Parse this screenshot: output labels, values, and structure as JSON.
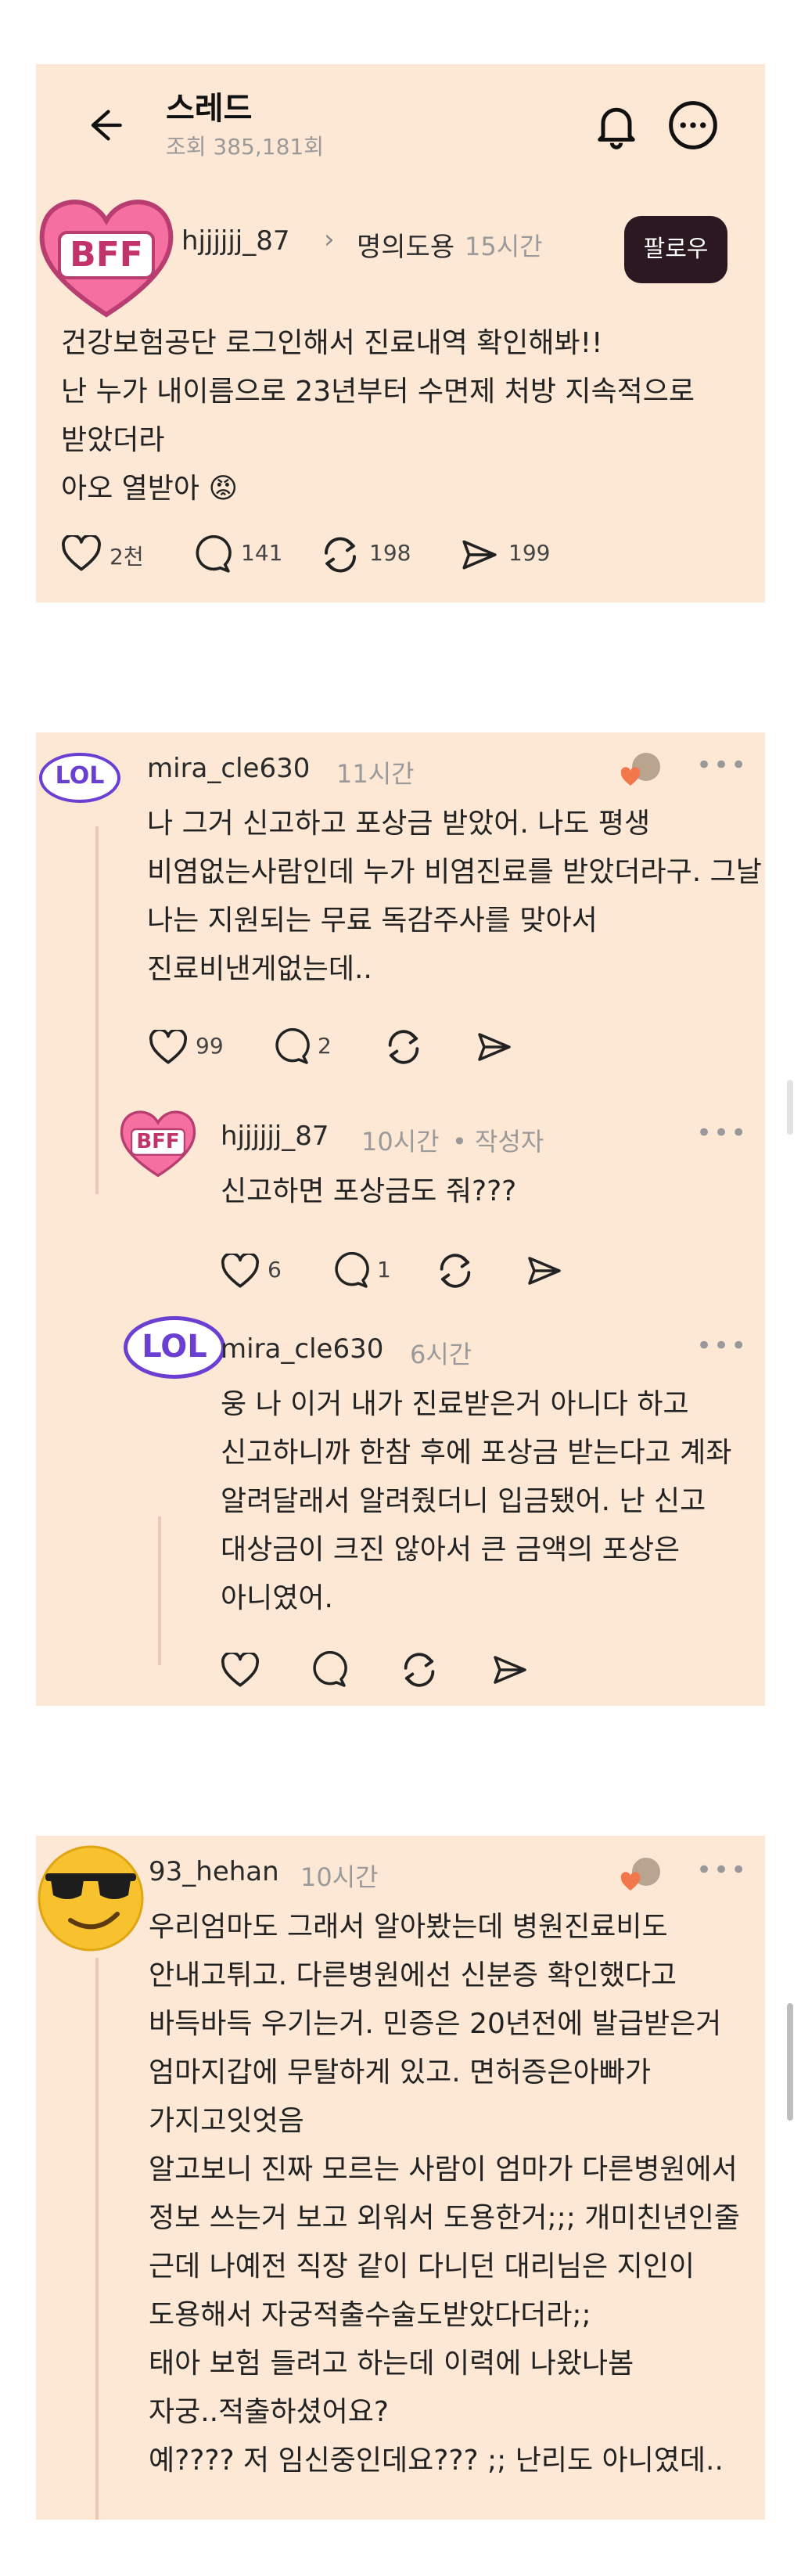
{
  "header": {
    "title": "스레드",
    "views": "조회 385,181회"
  },
  "post": {
    "avatar_text": "BFF",
    "username": "hjjjjjj_87",
    "community": "명의도용",
    "time": "15시간",
    "follow_label": "팔로우",
    "lines": [
      "건강보험공단 로그인해서 진료내역 확인해봐!!",
      "난 누가 내이름으로 23년부터 수면제 처방 지속적으로",
      "받았더라",
      "아오 열받아 😡"
    ],
    "likes": "2천",
    "comments": "141",
    "reposts": "198",
    "shares": "199"
  },
  "reply1": {
    "avatar_text": "LOL",
    "username": "mira_cle630",
    "time": "11시간",
    "lines": [
      "나 그거 신고하고 포상금 받았어. 나도 평생",
      "비염없는사람인데 누가 비염진료를 받았더라구. 그날",
      "나는 지원되는 무료 독감주사를 맞아서",
      "진료비낸게없는데.."
    ],
    "likes": "99",
    "comments": "2"
  },
  "reply1a": {
    "avatar_text": "BFF",
    "username": "hjjjjjj_87",
    "time": "10시간",
    "author_tag": "• 작성자",
    "lines": [
      "신고하면 포상금도 줘???"
    ],
    "likes": "6",
    "comments": "1"
  },
  "reply1b": {
    "avatar_text": "LOL",
    "username": "mira_cle630",
    "time": "6시간",
    "lines": [
      "웅 나 이거 내가 진료받은거 아니다 하고",
      "신고하니까 한참 후에 포상금 받는다고 계좌",
      "알려달래서 알려줬더니 입금됐어. 난 신고",
      "대상금이 크진 않아서 큰 금액의 포상은",
      "아니였어."
    ]
  },
  "reply2": {
    "username": "93_hehan",
    "time": "10시간",
    "lines": [
      "우리엄마도 그래서 알아봤는데 병원진료비도",
      "안내고튀고. 다른병원에선 신분증 확인했다고",
      "바득바득 우기는거. 민증은 20년전에 발급받은거",
      "엄마지갑에 무탈하게 있고. 면허증은아빠가",
      "가지고잇엇음",
      "알고보니 진짜 모르는 사람이 엄마가 다른병원에서",
      "정보 쓰는거 보고 외워서 도용한거;;; 개미친년인줄",
      "근데 나예전 직장 같이 다니던 대리님은 지인이",
      "도용해서 자궁적출수술도받았다더라;;",
      "태아 보험 들려고 하는데 이력에 나왔나봄",
      "자궁..적출하셨어요?",
      "예???? 저 임신중인데요??? ;; 난리도 아니였데.."
    ]
  },
  "colors": {
    "card_bg": "#fde8d6",
    "follow_bg": "#2b1820",
    "bff_pink": "#f56fa0",
    "lol_purple": "#6a3fd1"
  }
}
